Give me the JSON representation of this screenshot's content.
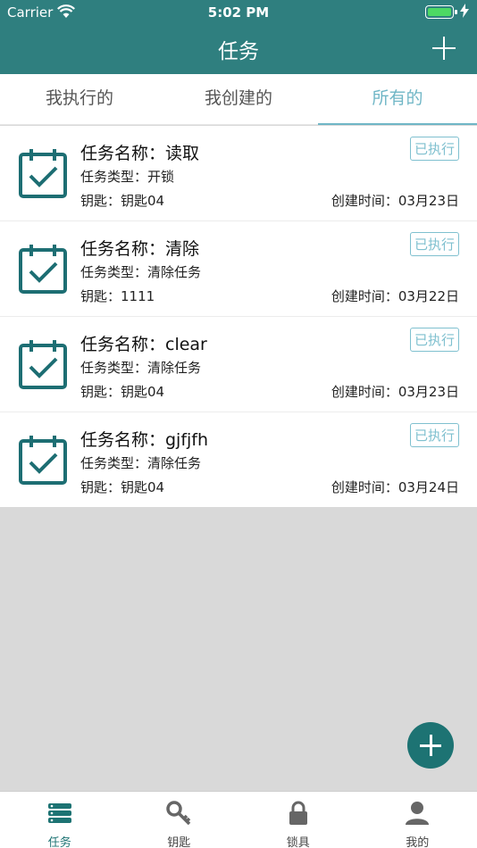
{
  "status_bar": {
    "carrier": "Carrier",
    "time": "5:02 PM"
  },
  "header": {
    "title": "任务"
  },
  "tabs": [
    {
      "label": "我执行的",
      "active": false
    },
    {
      "label": "我创建的",
      "active": false
    },
    {
      "label": "所有的",
      "active": true
    }
  ],
  "tasks": [
    {
      "name": "任务名称：读取",
      "type": "任务类型：开锁",
      "key": "钥匙：钥匙04",
      "created": "创建时间：03月23日",
      "status": "已执行"
    },
    {
      "name": "任务名称：清除",
      "type": "任务类型：清除任务",
      "key": "钥匙：1111",
      "created": "创建时间：03月22日",
      "status": "已执行"
    },
    {
      "name": "任务名称：clear",
      "type": "任务类型：清除任务",
      "key": "钥匙：钥匙04",
      "created": "创建时间：03月23日",
      "status": "已执行"
    },
    {
      "name": "任务名称：gjfjfh",
      "type": "任务类型：清除任务",
      "key": "钥匙：钥匙04",
      "created": "创建时间：03月24日",
      "status": "已执行"
    }
  ],
  "tabbar": [
    {
      "label": "任务",
      "icon": "server-stack-icon",
      "active": true
    },
    {
      "label": "钥匙",
      "icon": "key-icon",
      "active": false
    },
    {
      "label": "锁具",
      "icon": "lock-icon",
      "active": false
    },
    {
      "label": "我的",
      "icon": "user-icon",
      "active": false
    }
  ],
  "colors": {
    "primary": "#2f7f7f",
    "accent": "#6fb6c6",
    "fab": "#1d7373"
  }
}
